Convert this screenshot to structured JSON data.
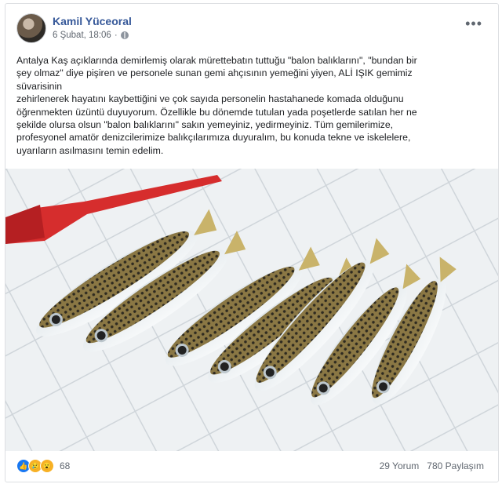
{
  "post": {
    "author": "Kamil Yüceoral",
    "date": "6 Şubat, 18:06",
    "more_label": "•••",
    "text_lines": [
      "Antalya Kaş açıklarında demirlemiş olarak mürettebatın tuttuğu \"balon balıklarını\", \"bundan bir",
      "şey olmaz\" diye pişiren ve personele sunan gemi ahçısının yemeğini yiyen, ALİ IŞIK gemimiz",
      "süvarisinin",
      "zehirlenerek hayatını kaybettiğini ve çok sayıda personelin hastahanede komada olduğunu",
      "öğrenmekten üzüntü duyuyorum. Özellikle bu dönemde tutulan yada poşetlerde satılan her ne",
      "şekilde olursa olsun \"balon balıklarını\" sakın yemeyiniz, yedirmeyiniz. Tüm gemilerimize,",
      "profesyonel amatör denizcilerimize balıkçılarımıza duyuralım, bu konuda tekne ve iskelelere,",
      "uyarıların asılmasını temin edelim."
    ]
  },
  "footer": {
    "reaction_count": "68",
    "comments": "29 Yorum",
    "shares": "780 Paylaşım"
  },
  "icons": {
    "like": "like-icon",
    "sad": "sad-icon",
    "wow": "wow-icon",
    "globe": "globe-icon"
  }
}
